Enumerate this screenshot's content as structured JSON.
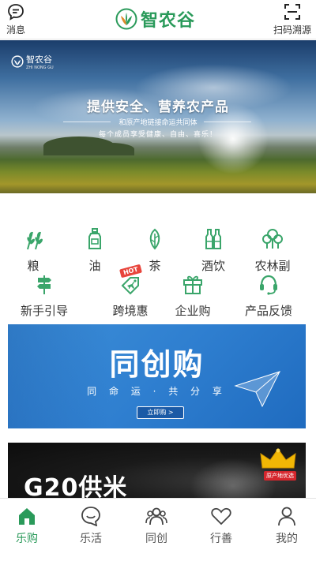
{
  "header": {
    "messages_label": "消息",
    "brand_name": "智农谷",
    "scan_label": "扫码溯源"
  },
  "hero": {
    "logo_text": "智农谷",
    "logo_sub": "ZHI NONG GU",
    "title": "提供安全、营养农产品",
    "subtitle": "和原产地链接命运共同体",
    "subtitle2": "每个成员享受健康、自由、喜乐！"
  },
  "categories": [
    {
      "label": "粮",
      "icon": "grain-icon"
    },
    {
      "label": "油",
      "icon": "oil-bottle-icon"
    },
    {
      "label": "茶",
      "icon": "tea-leaf-icon"
    },
    {
      "label": "酒饮",
      "icon": "bottles-icon"
    },
    {
      "label": "农林副",
      "icon": "trees-icon"
    },
    {
      "label": "新手引导",
      "icon": "signpost-icon"
    },
    {
      "label": "跨境惠",
      "icon": "airplane-tag-icon"
    },
    {
      "label": "企业购",
      "icon": "gift-box-icon"
    },
    {
      "label": "产品反馈",
      "icon": "headset-icon"
    }
  ],
  "hot_badge": "HOT",
  "banner_tongchuang": {
    "title": "同创购",
    "slogan": "同 命 运 · 共 分 享",
    "button": "立即购 >"
  },
  "banner_g20": {
    "title": "G20供米",
    "tag": "原产地优选"
  },
  "tabs": [
    {
      "label": "乐购",
      "icon": "home-icon",
      "active": true
    },
    {
      "label": "乐活",
      "icon": "chat-smile-icon",
      "active": false
    },
    {
      "label": "同创",
      "icon": "group-icon",
      "active": false
    },
    {
      "label": "行善",
      "icon": "heart-icon",
      "active": false
    },
    {
      "label": "我的",
      "icon": "user-icon",
      "active": false
    }
  ],
  "colors": {
    "brand_green": "#2a9a5a",
    "icon_green": "#3aa56a",
    "banner_blue": "#2f7fd0",
    "hot_red": "#e8453c"
  }
}
